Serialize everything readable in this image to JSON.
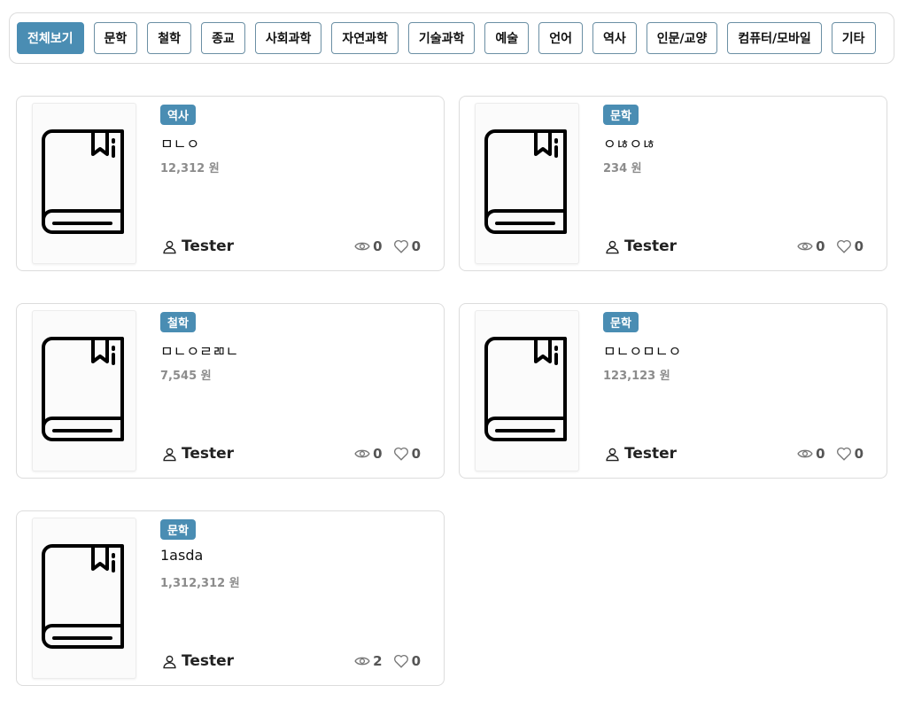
{
  "filters": [
    {
      "label": "전체보기",
      "active": true
    },
    {
      "label": "문학"
    },
    {
      "label": "철학"
    },
    {
      "label": "종교"
    },
    {
      "label": "사회과학"
    },
    {
      "label": "자연과학"
    },
    {
      "label": "기술과학"
    },
    {
      "label": "예술"
    },
    {
      "label": "언어"
    },
    {
      "label": "역사"
    },
    {
      "label": "인문/교양"
    },
    {
      "label": "컴퓨터/모바일"
    },
    {
      "label": "기타"
    }
  ],
  "books": [
    {
      "category": "역사",
      "title": "ㅁㄴㅇ",
      "price": "12,312 원",
      "author": "Tester",
      "views": "0",
      "likes": "0"
    },
    {
      "category": "문학",
      "title": "ㅇㄶㅇㄶ",
      "price": "234 원",
      "author": "Tester",
      "views": "0",
      "likes": "0"
    },
    {
      "category": "철학",
      "title": "ㅁㄴㅇㄹㄻㄴ",
      "price": "7,545 원",
      "author": "Tester",
      "views": "0",
      "likes": "0"
    },
    {
      "category": "문학",
      "title": "ㅁㄴㅇㅁㄴㅇ",
      "price": "123,123 원",
      "author": "Tester",
      "views": "0",
      "likes": "0"
    },
    {
      "category": "문학",
      "title": "1asda",
      "price": "1,312,312 원",
      "author": "Tester",
      "views": "2",
      "likes": "0"
    }
  ],
  "icons": {
    "cover": "book-icon",
    "author": "user-icon",
    "views": "eye-icon",
    "likes": "heart-icon"
  },
  "colors": {
    "accent": "#4a8db3",
    "chip_border": "#6b8fa4",
    "price_text": "#8c8c8c",
    "card_border": "#dcdcdc"
  }
}
